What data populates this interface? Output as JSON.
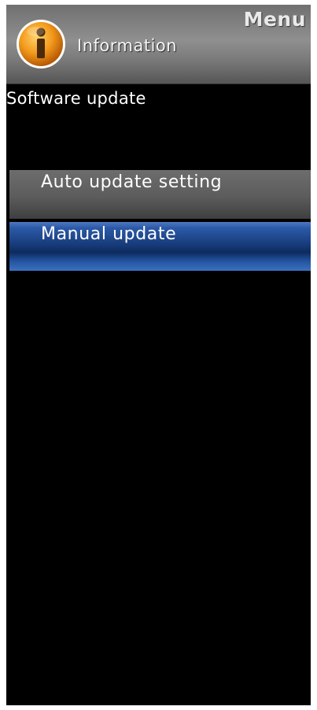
{
  "header": {
    "menu_label": "Menu",
    "section_label": "Information",
    "icon": "info-icon"
  },
  "page": {
    "title": "Software update"
  },
  "menu": {
    "items": [
      {
        "label": "Auto update setting",
        "selected": false
      },
      {
        "label": "Manual update",
        "selected": true
      }
    ]
  },
  "colors": {
    "background": "#000000",
    "header": "#8f8f8f",
    "item": "#5c5c5c",
    "selected_item": "#2c5aa8",
    "icon_orange": "#f0a020"
  }
}
